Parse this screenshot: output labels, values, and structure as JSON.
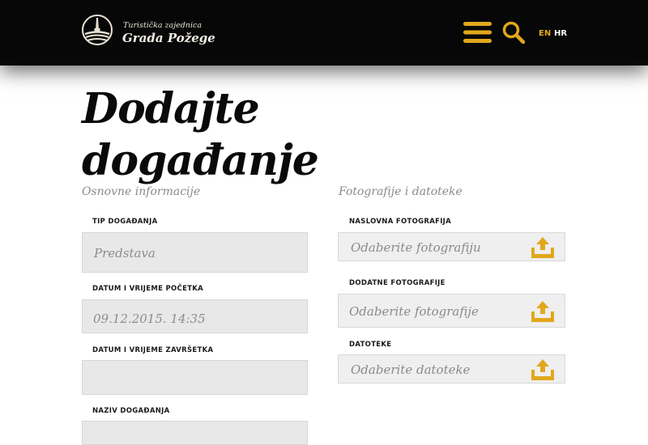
{
  "header": {
    "logo": {
      "line1": "Turistička zajednica",
      "line2": "Grada Požege",
      "icon": "bell-tower-emblem-icon"
    },
    "menu_icon": "hamburger-menu-icon",
    "search_icon": "search-icon",
    "languages": [
      {
        "code": "EN",
        "active": true
      },
      {
        "code": "HR",
        "active": false
      }
    ],
    "accent_color": "#e0a81c",
    "background_color": "#070707"
  },
  "page": {
    "title_line1": "Dodajte",
    "title_line2": "događanje"
  },
  "basic_info": {
    "section_title": "Osnovne informacije",
    "fields": [
      {
        "label": "TIP DOGAĐANJA",
        "value": "Predstava"
      },
      {
        "label": "DATUM I VRIJEME POČETKA",
        "value": "09.12.2015. 14:35"
      },
      {
        "label": "DATUM I VRIJEME ZAVRŠETKA",
        "value": ""
      },
      {
        "label": "NAZIV DOGAĐANJA",
        "value": ""
      }
    ]
  },
  "media": {
    "section_title": "Fotografije i datoteke",
    "uploads": [
      {
        "label": "NASLOVNA FOTOGRAFIJA",
        "placeholder": "Odaberite fotografiju",
        "icon": "upload-icon"
      },
      {
        "label": "DODATNE FOTOGRAFIJE",
        "placeholder": "Odaberite fotografije",
        "icon": "upload-icon"
      },
      {
        "label": "DATOTEKE",
        "placeholder": "Odaberite datoteke",
        "icon": "upload-icon"
      }
    ]
  }
}
